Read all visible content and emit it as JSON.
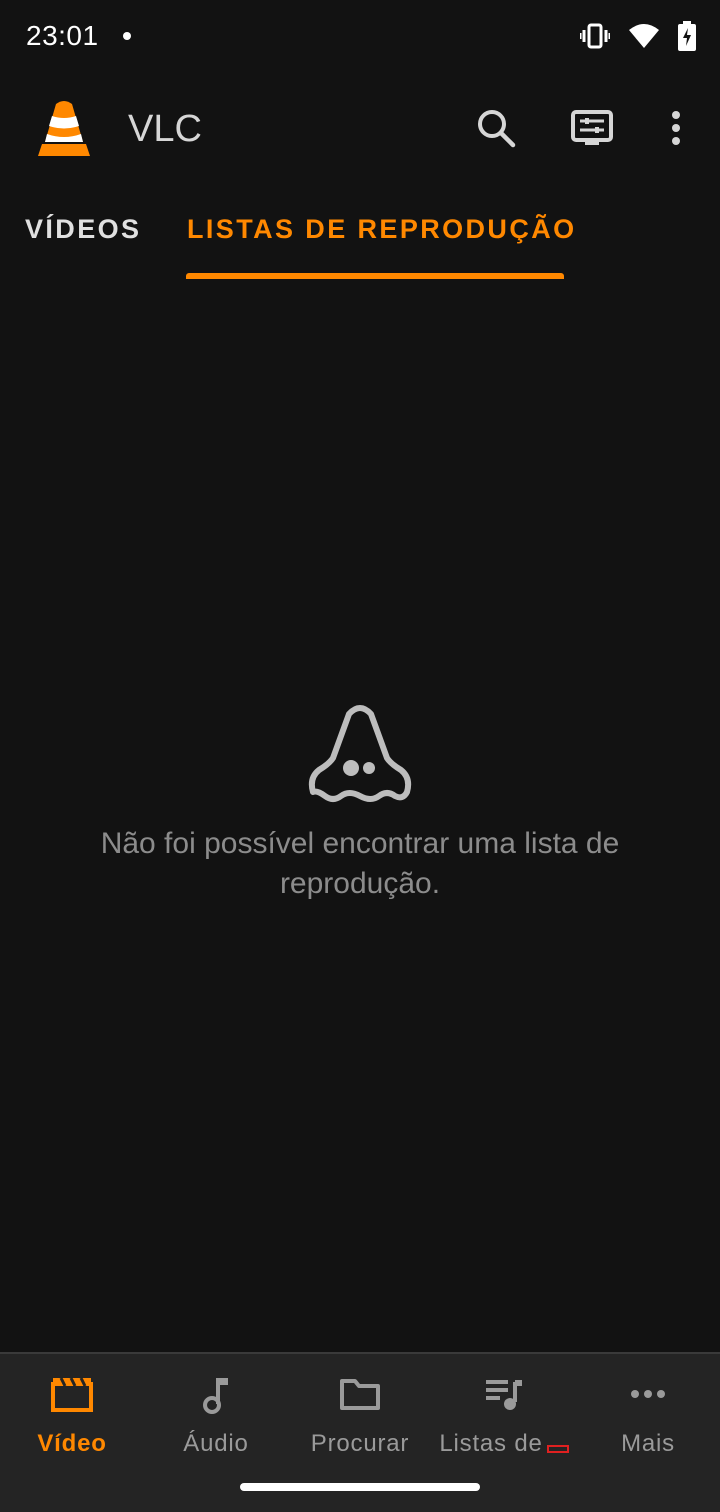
{
  "status_bar": {
    "time": "23:01",
    "icons": [
      "notification-dot",
      "vibrate-icon",
      "wifi-icon",
      "battery-charging-icon"
    ]
  },
  "app_bar": {
    "title": "VLC",
    "icons": [
      "vlc-logo",
      "search-icon",
      "cast-renderer-icon",
      "more-vert-icon"
    ]
  },
  "tabs": [
    {
      "label": "VÍDEOS",
      "selected": false
    },
    {
      "label": "LISTAS DE REPRODUÇÃO",
      "selected": true
    }
  ],
  "empty_state": {
    "icon": "ghost-cone-icon",
    "message": "Não foi possível encontrar uma lista de reprodução."
  },
  "bottom_nav": [
    {
      "label": "Vídeo",
      "icon": "movie-icon",
      "selected": true
    },
    {
      "label": "Áudio",
      "icon": "music-note-icon",
      "selected": false
    },
    {
      "label": "Procurar",
      "icon": "folder-icon",
      "selected": false
    },
    {
      "label": "Listas de",
      "icon": "playlist-icon",
      "selected": false
    },
    {
      "label": "Mais",
      "icon": "more-horiz-icon",
      "selected": false
    }
  ],
  "colors": {
    "accent": "#ff8800",
    "background": "#121212",
    "nav_background": "#242424",
    "muted_text": "#8c8c8c"
  }
}
